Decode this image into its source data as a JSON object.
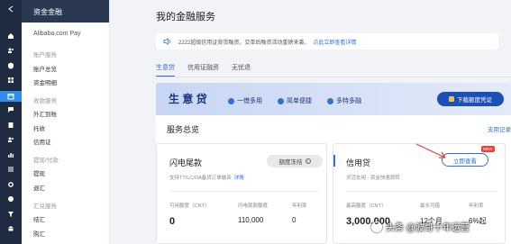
{
  "sidebar": {
    "header": "资金金融",
    "brand": "Alibaba.com Pay",
    "groups": [
      {
        "label": "账户服务",
        "items": [
          "账户总览",
          "资金明细"
        ]
      },
      {
        "label": "收款服务",
        "items": [
          "外汇到账",
          "托收",
          "信用证"
        ]
      },
      {
        "label": "提现/付款",
        "items": [
          "提现",
          "退汇"
        ]
      },
      {
        "label": "汇兑服务",
        "items": [
          "结汇",
          "购汇"
        ]
      }
    ]
  },
  "rail": {
    "icons": [
      "chevron-left-icon",
      "home-icon",
      "people-icon",
      "shield-icon",
      "grid-icon",
      "calendar-icon",
      "chat-icon",
      "receipt-icon",
      "people-icon",
      "chart-icon",
      "list-icon",
      "gear-icon",
      "info-icon",
      "funnel-icon",
      "bank-icon"
    ],
    "active_index": 5
  },
  "page": {
    "title": "我的金融服务",
    "notice": "2222超级信用证背货融资，交单后融资活动重磅来袭，",
    "notice_link": "点此立即查看详情",
    "tabs": [
      "生意贷",
      "信用证融资",
      "无忧退"
    ],
    "active_tab": 0
  },
  "banner": {
    "title": "生 意 贷",
    "features": [
      "一借多用",
      "简单便捷",
      "多特多融"
    ],
    "download_button": "下载额度凭证"
  },
  "overview": {
    "title": "服务总览",
    "record_link": "支用记录"
  },
  "cards": {
    "flash": {
      "title": "闪电尾款",
      "status_button": "额度冻结",
      "desc": "支持TT/LC/OA备货订单融资",
      "desc_link": "详情",
      "labels": [
        "可用额度（CNY）",
        "闪电尾款额度",
        "年利率"
      ],
      "values": [
        "0",
        "110,000",
        "0"
      ]
    },
    "credit": {
      "title": "信用贷",
      "apply_button": "立即查看",
      "new_badge": "NEW",
      "desc": "灵活支用  ·  资金快速周转",
      "labels": [
        "最高额度（CNY）",
        "最长可借",
        "年利率"
      ],
      "values": [
        "3,000,000",
        "12个月",
        "6%起"
      ]
    }
  },
  "watermark": "头条 @波哥十年运营",
  "colors": {
    "accent": "#2f6fe0",
    "rail": "#1f2b40",
    "banner_button": "#1d4fb8",
    "badge": "#e5413a"
  }
}
